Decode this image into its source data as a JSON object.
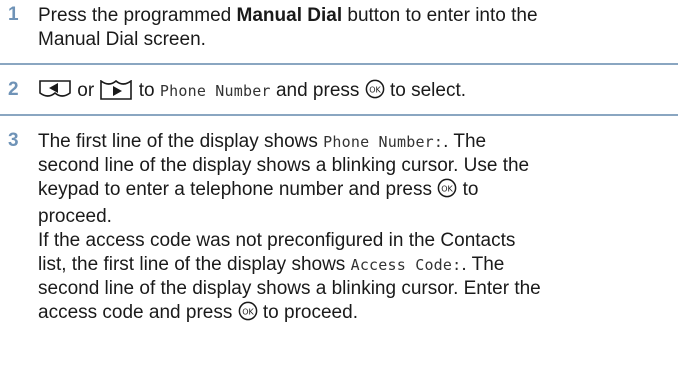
{
  "steps": [
    {
      "number": "1",
      "text_before": "Press the programmed ",
      "bold": "Manual Dial",
      "text_after_line1": " button to enter into the",
      "text_line2": "Manual Dial screen."
    },
    {
      "number": "2",
      "or_text": "or",
      "to_text": "to",
      "target": "Phone Number",
      "and_press": "and press",
      "to_select": "to select."
    },
    {
      "number": "3",
      "l1_a": "The first line of the display shows ",
      "l1_mono": "Phone Number:",
      "l1_b": ". The",
      "l2": "second line of the display shows a blinking cursor. Use the",
      "l3_a": "keypad to enter a telephone number and press",
      "l3_b": "to",
      "l4": "proceed.",
      "l5": "If the access code was not preconfigured in the Contacts",
      "l6_a": "list, the first line of the display shows ",
      "l6_mono": "Access Code:",
      "l6_b": ". The",
      "l7": "second line of the display shows a blinking cursor. Enter the",
      "l8_a": "access code and press",
      "l8_b": "to proceed."
    }
  ],
  "icons": [
    "left-arrow-key-icon",
    "right-arrow-key-icon",
    "ok-key-icon"
  ],
  "colors": {
    "step_number": "#6f93b7",
    "divider": "#8aa6c1"
  }
}
